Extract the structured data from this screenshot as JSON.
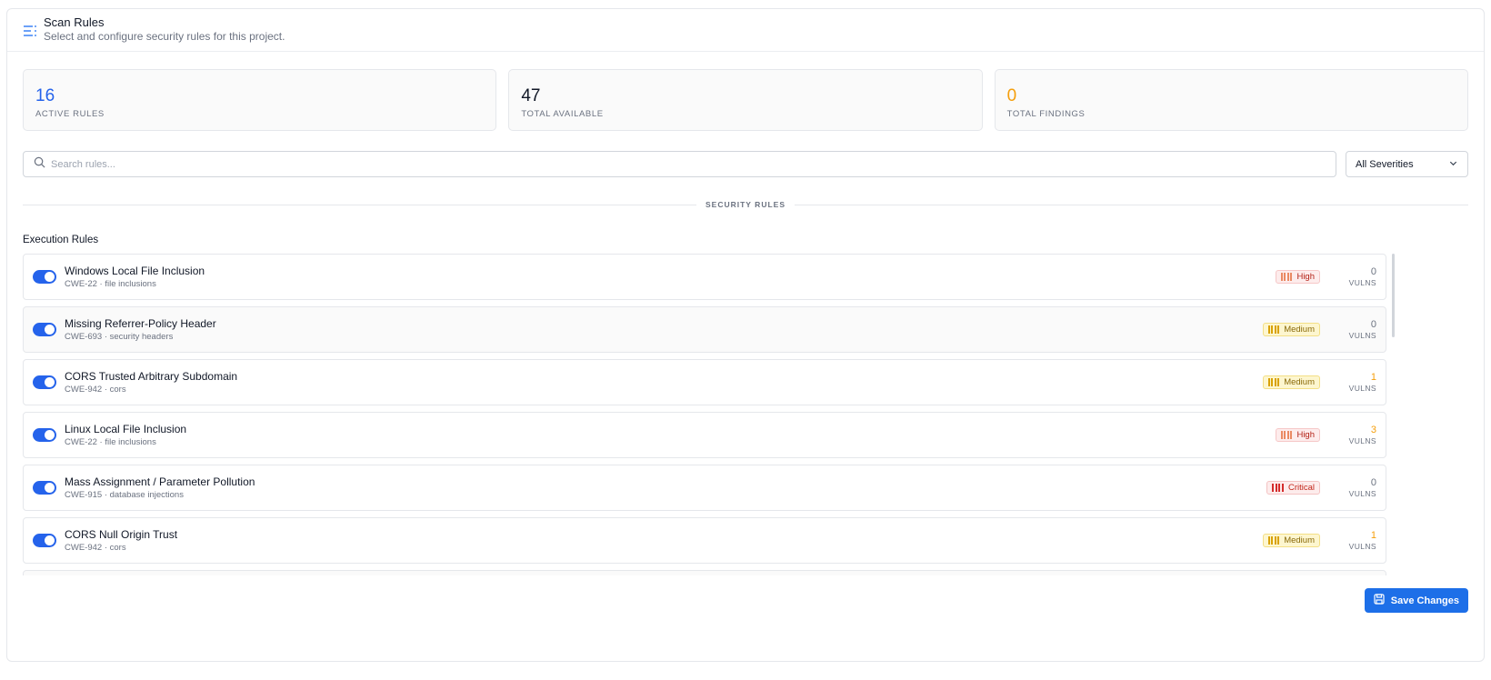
{
  "header": {
    "title": "Scan Rules",
    "subtitle": "Select and configure security rules for this project.",
    "icon": "list-settings-icon"
  },
  "stats": [
    {
      "value": "16",
      "label": "ACTIVE RULES",
      "color": "#2563eb"
    },
    {
      "value": "47",
      "label": "TOTAL AVAILABLE",
      "color": "#111827"
    },
    {
      "value": "0",
      "label": "TOTAL FINDINGS",
      "color": "#f59e0b"
    }
  ],
  "search": {
    "placeholder": "Search rules...",
    "value": ""
  },
  "severity_filter": {
    "selected": "All Severities"
  },
  "section_label": "SECURITY RULES",
  "group_title": "Execution Rules",
  "rules": [
    {
      "name": "Windows Local File Inclusion",
      "meta": "CWE-22 · file inclusions",
      "severity": "High",
      "vulns": "0",
      "vulns_label": "VULNS",
      "enabled": true
    },
    {
      "name": "Missing Referrer-Policy Header",
      "meta": "CWE-693 · security headers",
      "severity": "Medium",
      "vulns": "0",
      "vulns_label": "VULNS",
      "enabled": true
    },
    {
      "name": "CORS Trusted Arbitrary Subdomain",
      "meta": "CWE-942 · cors",
      "severity": "Medium",
      "vulns": "1",
      "vulns_label": "VULNS",
      "enabled": true
    },
    {
      "name": "Linux Local File Inclusion",
      "meta": "CWE-22 · file inclusions",
      "severity": "High",
      "vulns": "3",
      "vulns_label": "VULNS",
      "enabled": true
    },
    {
      "name": "Mass Assignment / Parameter Pollution",
      "meta": "CWE-915 · database injections",
      "severity": "Critical",
      "vulns": "0",
      "vulns_label": "VULNS",
      "enabled": true
    },
    {
      "name": "CORS Null Origin Trust",
      "meta": "CWE-942 · cors",
      "severity": "Medium",
      "vulns": "1",
      "vulns_label": "VULNS",
      "enabled": true
    }
  ],
  "save_button": {
    "label": "Save Changes",
    "icon": "save-icon"
  },
  "colors": {
    "accent": "#1d6fe8",
    "findings": "#f59e0b"
  }
}
